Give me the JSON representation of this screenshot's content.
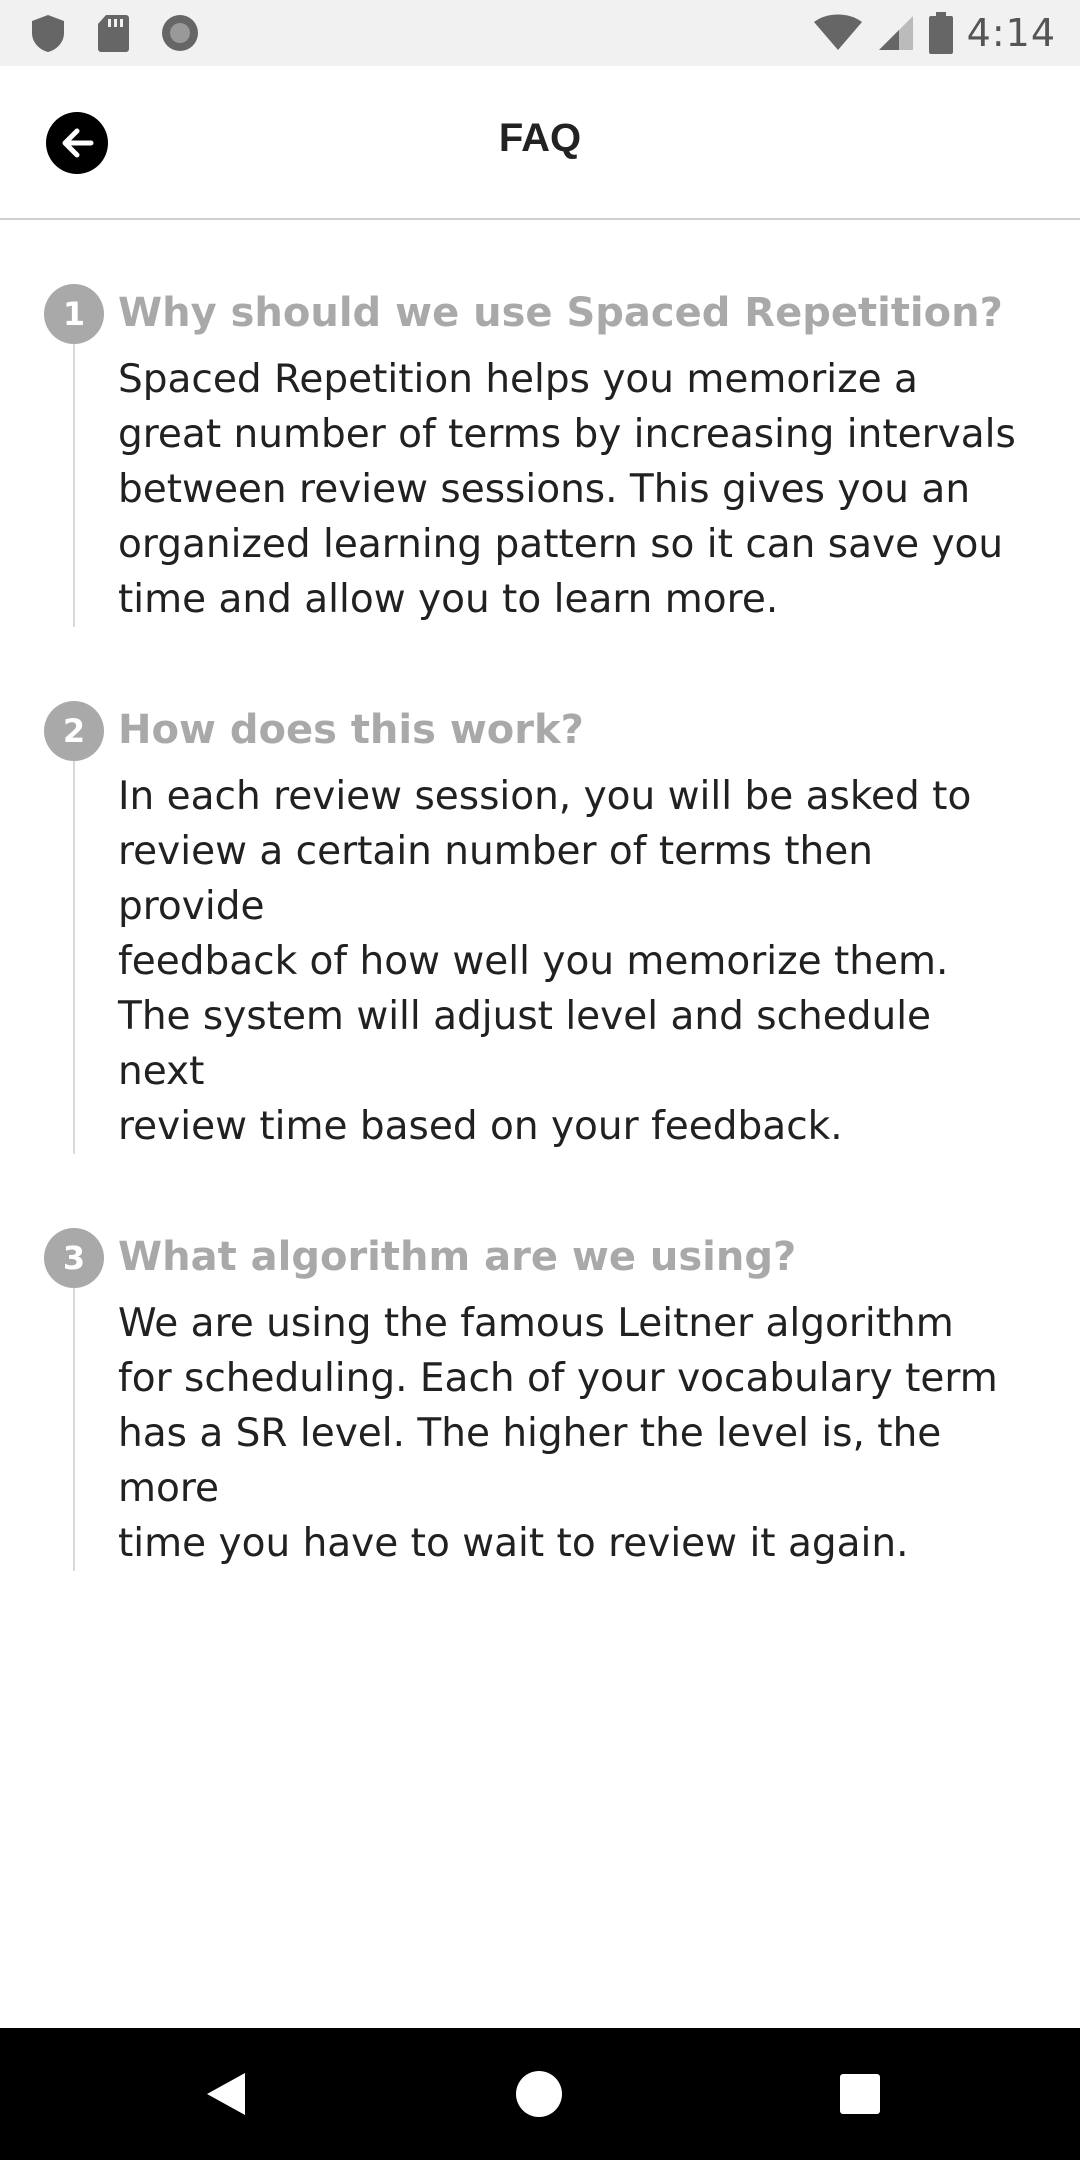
{
  "status_bar": {
    "time": "4:14",
    "icons": [
      "shield-icon",
      "sd-card-icon",
      "circle-icon",
      "wifi-icon",
      "signal-icon",
      "battery-icon"
    ]
  },
  "app_bar": {
    "title": "FAQ",
    "back_icon": "arrow-left-icon"
  },
  "faq": [
    {
      "number": "1",
      "question": "Why should we use Spaced Repetition?",
      "answer_lines": [
        "Spaced Repetition helps you memorize a",
        "great number of terms by increasing intervals",
        "between review sessions. This gives you an",
        "organized learning pattern so it can save you",
        "time and allow you to learn more."
      ]
    },
    {
      "number": "2",
      "question": "How does this work?",
      "answer_lines": [
        "In each review session, you will be asked to",
        "review a certain number of terms then provide",
        "feedback of how well you memorize them.",
        "The system will adjust level and schedule next",
        "review time based on your feedback."
      ]
    },
    {
      "number": "3",
      "question": "What algorithm are we using?",
      "answer_lines": [
        "We are using the famous Leitner algorithm",
        "for scheduling. Each of your vocabulary term",
        "has a SR level. The higher the level is, the more",
        "time you have to wait to review it again."
      ]
    }
  ],
  "nav_bar": {
    "buttons": [
      "back-triangle-icon",
      "home-circle-icon",
      "recents-square-icon"
    ]
  },
  "colors": {
    "accent_gray": "#a9a9a9",
    "text": "#212121",
    "nav_bg": "#000000",
    "status_bg": "#f1f1f1"
  }
}
